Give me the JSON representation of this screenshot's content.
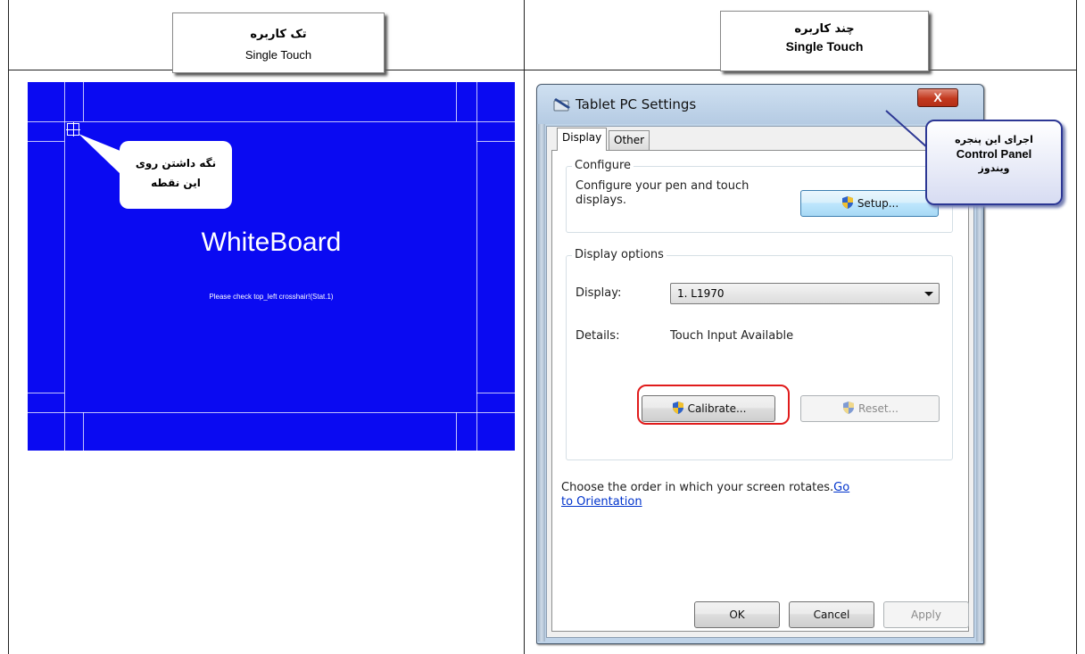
{
  "headers": {
    "left": {
      "fa": "تک کاربره",
      "en": "Single Touch"
    },
    "right": {
      "fa": "چند کاربره",
      "en": "Single Touch"
    }
  },
  "whiteboard": {
    "title": "WhiteBoard",
    "message": "Please check top_left crosshair!(Stat.1)",
    "callout": {
      "line1": "نگه داشتن روی",
      "line2": "این نقطه"
    },
    "bg_color": "#0a0af2"
  },
  "dialog": {
    "title": "Tablet PC Settings",
    "close_label": "X",
    "tabs": [
      {
        "label": "Display",
        "active": true
      },
      {
        "label": "Other",
        "active": false
      }
    ],
    "configure": {
      "legend": "Configure",
      "text_line1": "Configure your pen and touch",
      "text_line2": "displays.",
      "setup_button": "Setup..."
    },
    "display_options": {
      "legend": "Display options",
      "display_label": "Display:",
      "display_value": "1. L1970",
      "details_label": "Details:",
      "details_value": "Touch Input Available",
      "calibrate_button": "Calibrate...",
      "reset_button": "Reset..."
    },
    "orientation": {
      "text": "Choose the order in which your screen rotates.",
      "link_part1": "Go",
      "link_part2": "to Orientation"
    },
    "footer": {
      "ok": "OK",
      "cancel": "Cancel",
      "apply": "Apply"
    }
  },
  "callout_right": {
    "line1": "اجرای این پنجره",
    "line2": "Control Panel",
    "line3": "ویندوز"
  },
  "colors": {
    "highlight": "#e01b1b",
    "callout_border": "#2c3794"
  }
}
